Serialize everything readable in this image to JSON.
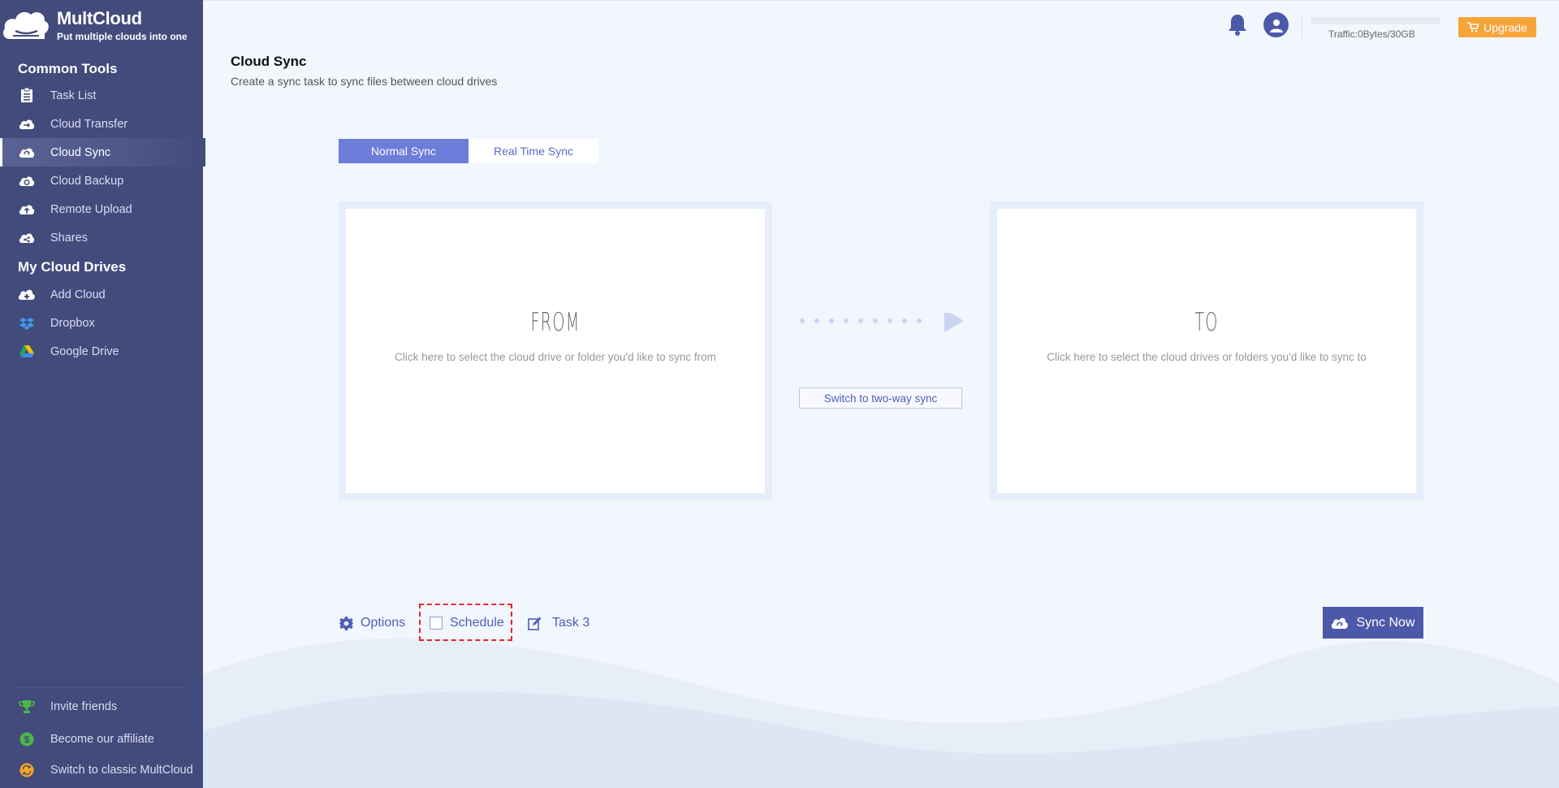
{
  "app": {
    "name": "MultCloud",
    "tagline": "Put multiple clouds into one"
  },
  "sidebar": {
    "common_tools_title": "Common Tools",
    "common_tools": [
      {
        "label": "Task List",
        "icon": "clipboard-icon"
      },
      {
        "label": "Cloud Transfer",
        "icon": "cloud-transfer-icon"
      },
      {
        "label": "Cloud Sync",
        "icon": "cloud-sync-icon",
        "active": true
      },
      {
        "label": "Cloud Backup",
        "icon": "cloud-backup-icon"
      },
      {
        "label": "Remote Upload",
        "icon": "cloud-upload-icon"
      },
      {
        "label": "Shares",
        "icon": "cloud-share-icon"
      }
    ],
    "my_drives_title": "My Cloud Drives",
    "my_drives": [
      {
        "label": "Add Cloud",
        "icon": "cloud-add-icon"
      },
      {
        "label": "Dropbox",
        "icon": "dropbox-icon"
      },
      {
        "label": "Google Drive",
        "icon": "google-drive-icon"
      }
    ],
    "footer": [
      {
        "label": "Invite friends",
        "icon": "trophy-icon"
      },
      {
        "label": "Become our affiliate",
        "icon": "dollar-icon"
      },
      {
        "label": "Switch to classic MultCloud",
        "icon": "switch-icon"
      }
    ]
  },
  "topbar": {
    "traffic": "Traffic:0Bytes/30GB",
    "traffic_used_fraction": 0,
    "upgrade_label": "Upgrade"
  },
  "header": {
    "title": "Cloud Sync",
    "subtitle": "Create a sync task to sync files between cloud drives"
  },
  "tabs": [
    {
      "label": "Normal Sync",
      "active": true
    },
    {
      "label": "Real Time Sync",
      "active": false
    }
  ],
  "from_panel": {
    "title": "FROM",
    "description": "Click here to select the cloud drive or folder you'd like to sync from"
  },
  "to_panel": {
    "title": "TO",
    "description": "Click here to select the cloud drives or folders you'd like to sync to"
  },
  "two_way_label": "Switch to two-way sync",
  "bottom": {
    "options_label": "Options",
    "schedule_label": "Schedule",
    "task_name": "Task 3",
    "sync_now_label": "Sync Now"
  },
  "colors": {
    "sidebar_bg": "#434b7c",
    "accent": "#4c58a8",
    "tab_active": "#6c7ed9",
    "upgrade": "#f7a53a",
    "highlight_dashed": "#e8252a"
  }
}
